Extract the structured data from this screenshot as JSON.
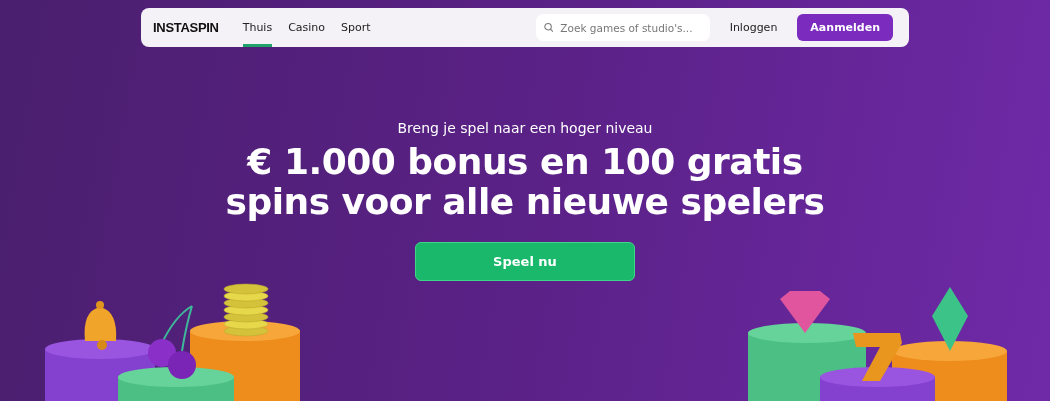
{
  "navbar": {
    "logo": "INSTASPIN",
    "links": [
      {
        "label": "Thuis",
        "selected": true
      },
      {
        "label": "Casino",
        "selected": false
      },
      {
        "label": "Sport",
        "selected": false
      }
    ],
    "search": {
      "placeholder": "Zoek games of studio's..."
    },
    "login": "Inloggen",
    "signup": "Aanmelden"
  },
  "hero": {
    "subtitle": "Breng je spel naar een hoger niveau",
    "title_lines": [
      "€ 1.000 bonus en 100 gratis",
      "spins voor alle nieuwe spelers"
    ],
    "cta": "Speel nu"
  }
}
